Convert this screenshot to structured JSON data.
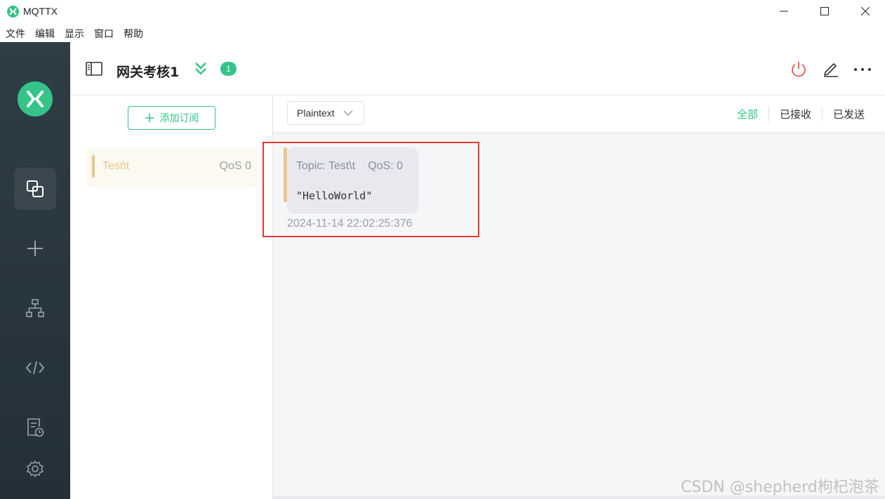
{
  "window": {
    "title": "MQTTX"
  },
  "menu": [
    "文件",
    "编辑",
    "显示",
    "窗口",
    "帮助"
  ],
  "sidebar": {
    "items": [
      {
        "icon": "connections-icon",
        "active": true
      },
      {
        "icon": "plus-icon",
        "active": false
      },
      {
        "icon": "topology-icon",
        "active": false
      },
      {
        "icon": "code-icon",
        "active": false
      },
      {
        "icon": "log-icon",
        "active": false
      },
      {
        "icon": "gear-icon",
        "active": false
      }
    ]
  },
  "header": {
    "title": "网关考核1",
    "badge_count": "1"
  },
  "subscriptions": {
    "add_label": "添加订阅",
    "items": [
      {
        "topic": "Test\\t",
        "qos": "QoS 0",
        "color": "#e7c78a"
      }
    ]
  },
  "messages": {
    "format": "Plaintext",
    "filters": [
      "全部",
      "已接收",
      "已发送"
    ],
    "items": [
      {
        "topic": "Topic: Test\\t",
        "qos": "QoS: 0",
        "payload": "\"HelloWorld\"",
        "time": "2024-11-14 22:02:25:376"
      }
    ]
  },
  "watermark": "CSDN @shepherd枸杞泡茶",
  "colors": {
    "accent": "#34c388",
    "sidebar_bg": "#2f3d46",
    "topic_color": "#e7c78a",
    "highlight": "#e23a32",
    "danger": "#e5584d"
  }
}
